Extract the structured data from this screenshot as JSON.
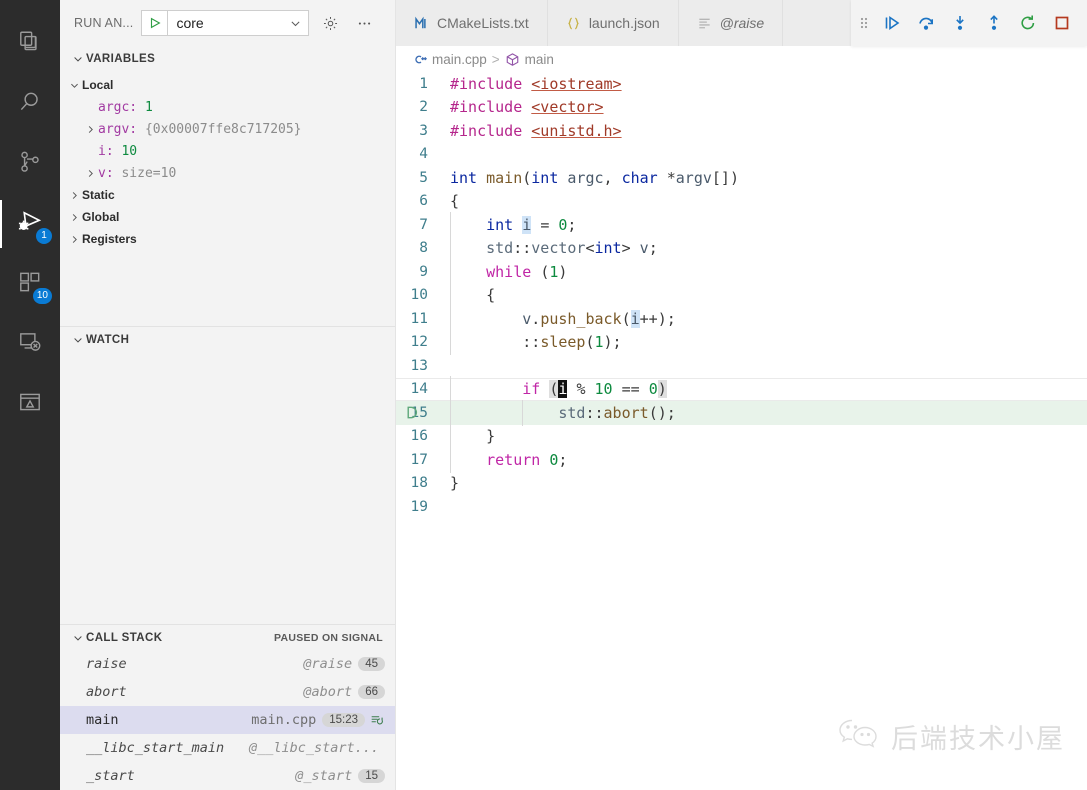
{
  "activitybar": {
    "items": [
      {
        "name": "explorer",
        "icon": "files-icon",
        "badge": null,
        "active": false
      },
      {
        "name": "search",
        "icon": "search-icon",
        "badge": null,
        "active": false
      },
      {
        "name": "source-control",
        "icon": "source-control-icon",
        "badge": null,
        "active": false
      },
      {
        "name": "run-and-debug",
        "icon": "run-debug-icon",
        "badge": "1",
        "active": true
      },
      {
        "name": "extensions",
        "icon": "extensions-icon",
        "badge": "10",
        "active": false
      },
      {
        "name": "remote-explorer",
        "icon": "remote-explorer-icon",
        "badge": null,
        "active": false
      },
      {
        "name": "testing",
        "icon": "testing-icon",
        "badge": null,
        "active": false
      }
    ],
    "badge_color": "#0a7bd4"
  },
  "sidebar": {
    "title": "RUN AN...",
    "launch_config": "core",
    "launch_play_icon": "play-icon",
    "caret_icon": "chevron-down-icon",
    "gear_icon": "gear-icon",
    "more_icon": "ellipsis-icon",
    "variables": {
      "header": "VARIABLES",
      "scopes": [
        {
          "label": "Local",
          "expanded": true,
          "entries": [
            {
              "name": "argc:",
              "value": "1",
              "value_type": "number",
              "expandable": false
            },
            {
              "name": "argv:",
              "value": "{0x00007ffe8c717205}",
              "value_type": "string",
              "expandable": true
            },
            {
              "name": "i:",
              "value": "10",
              "value_type": "number",
              "expandable": false
            },
            {
              "name": "v:",
              "value": "size=10",
              "value_type": "string",
              "expandable": true
            }
          ]
        },
        {
          "label": "Static",
          "expanded": false,
          "entries": []
        },
        {
          "label": "Global",
          "expanded": false,
          "entries": []
        },
        {
          "label": "Registers",
          "expanded": false,
          "entries": []
        }
      ]
    },
    "watch": {
      "header": "WATCH",
      "entries": []
    },
    "callstack": {
      "header": "CALL STACK",
      "status": "PAUSED ON SIGNAL",
      "frames": [
        {
          "name": "raise",
          "source": "@raise",
          "line": "45",
          "selected": false,
          "restart": false
        },
        {
          "name": "abort",
          "source": "@abort",
          "line": "66",
          "selected": false,
          "restart": false
        },
        {
          "name": "main",
          "source": "main.cpp",
          "line": "15:23",
          "selected": true,
          "restart": true
        },
        {
          "name": "__libc_start_main",
          "source": "@__libc_start...",
          "line": "",
          "selected": false,
          "restart": false
        },
        {
          "name": "_start",
          "source": "@_start",
          "line": "15",
          "selected": false,
          "restart": false
        }
      ]
    }
  },
  "editor": {
    "tabs": [
      {
        "label": "CMakeLists.txt",
        "icon": "cmake-icon",
        "active": false,
        "italic": false
      },
      {
        "label": "launch.json",
        "icon": "json-icon",
        "active": false,
        "italic": false
      },
      {
        "label": "@raise",
        "icon": "disassembly-icon",
        "active": false,
        "italic": true
      }
    ],
    "debug_toolbar": {
      "grip_icon": "drag-handle-icon",
      "buttons": [
        {
          "name": "continue-button",
          "icon": "continue-icon",
          "color": "#1b74c4"
        },
        {
          "name": "step-over-button",
          "icon": "step-over-icon",
          "color": "#1b74c4"
        },
        {
          "name": "step-into-button",
          "icon": "step-into-icon",
          "color": "#1b74c4"
        },
        {
          "name": "step-out-button",
          "icon": "step-out-icon",
          "color": "#1b74c4"
        },
        {
          "name": "restart-button",
          "icon": "restart-icon",
          "color": "#2f9e44"
        },
        {
          "name": "stop-button",
          "icon": "stop-icon",
          "color": "#b5391f"
        }
      ]
    },
    "breadcrumb": {
      "file_icon": "cpp-icon",
      "file": "main.cpp",
      "separator": ">",
      "symbol_icon": "namespace-cube-icon",
      "symbol": "main"
    },
    "current_line": 15,
    "file_name": "main.cpp",
    "lines": [
      {
        "n": "1",
        "text": "#include <iostream>"
      },
      {
        "n": "2",
        "text": "#include <vector>"
      },
      {
        "n": "3",
        "text": "#include <unistd.h>"
      },
      {
        "n": "4",
        "text": ""
      },
      {
        "n": "5",
        "text": "int main(int argc, char *argv[])"
      },
      {
        "n": "6",
        "text": "{"
      },
      {
        "n": "7",
        "text": "    int i = 0;"
      },
      {
        "n": "8",
        "text": "    std::vector<int> v;"
      },
      {
        "n": "9",
        "text": "    while (1)"
      },
      {
        "n": "10",
        "text": "    {"
      },
      {
        "n": "11",
        "text": "        v.push_back(i++);"
      },
      {
        "n": "12",
        "text": "        ::sleep(1);"
      },
      {
        "n": "13",
        "text": ""
      },
      {
        "n": "14",
        "text": "        if (i % 10 == 0)"
      },
      {
        "n": "15",
        "text": "            std::abort();"
      },
      {
        "n": "16",
        "text": "    }"
      },
      {
        "n": "17",
        "text": "    return 0;"
      },
      {
        "n": "18",
        "text": "}"
      },
      {
        "n": "19",
        "text": ""
      }
    ]
  },
  "watermark": {
    "text": "后端技术小屋",
    "icon": "wechat-icon"
  },
  "colors": {
    "activitybar_bg": "#2c2c2c",
    "sidebar_bg": "#f3f3f3",
    "editor_bg": "#ffffff",
    "tab_bg": "#ececec",
    "accent_blue": "#0a7bd4",
    "current_line_bg": "#e8f3ea",
    "selected_row_bg": "#dcdcef"
  }
}
